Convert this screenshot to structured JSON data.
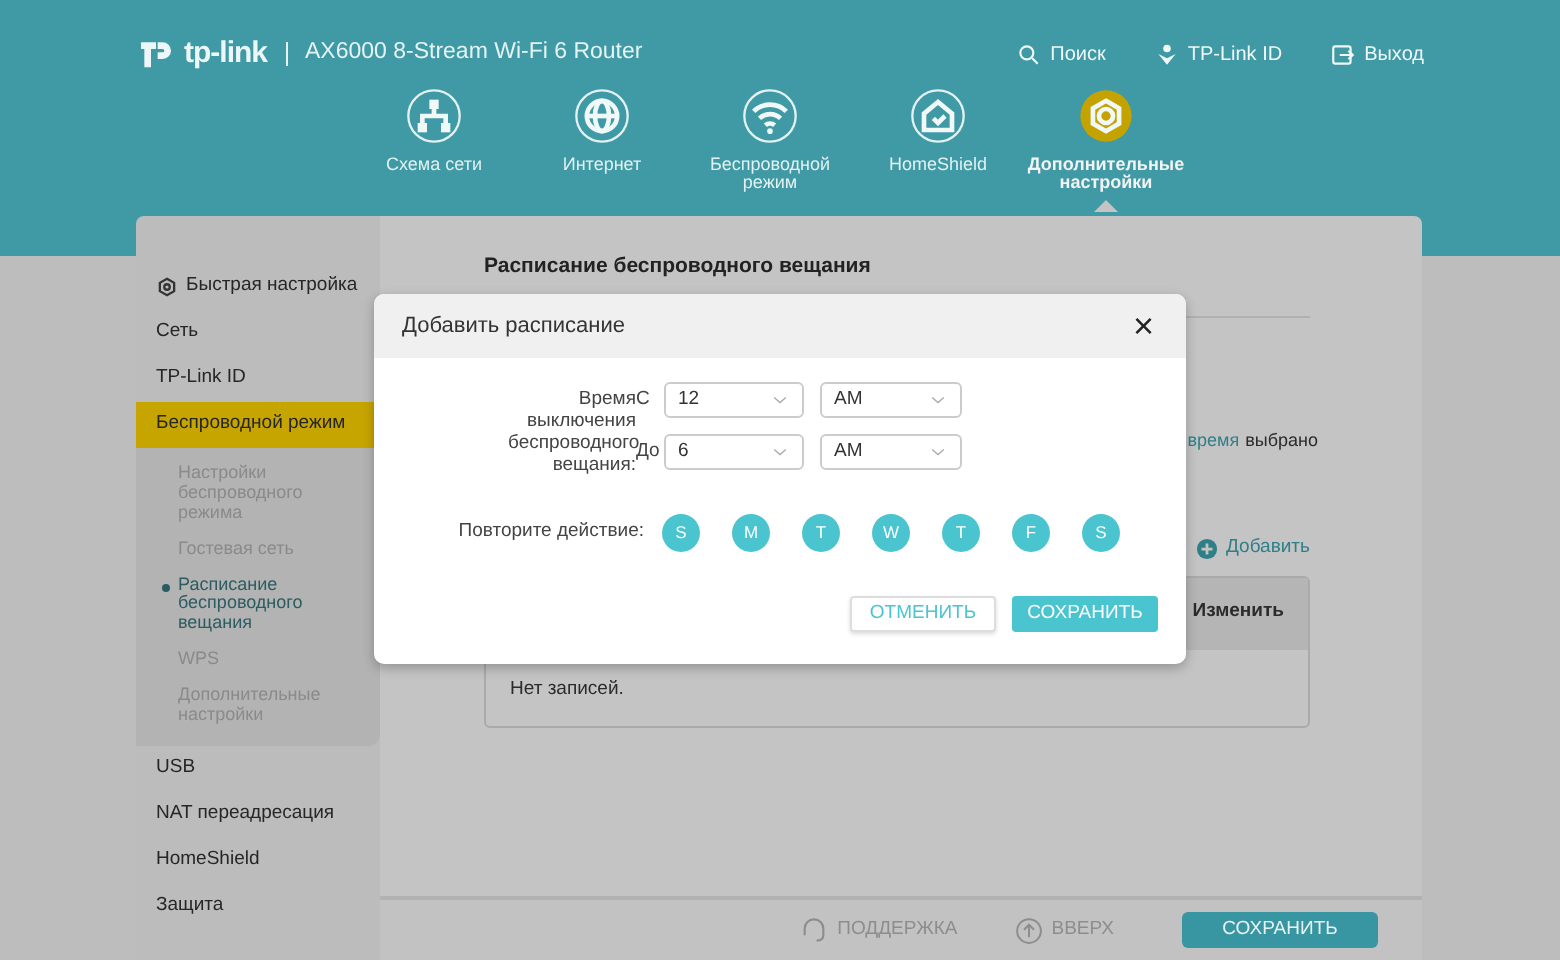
{
  "header": {
    "logo_text": "tp-link",
    "model": "AX6000 8-Stream Wi-Fi 6 Router",
    "links": [
      {
        "label": "Поиск",
        "kind": "search"
      },
      {
        "label": "TP-Link ID",
        "kind": "account"
      },
      {
        "label": "Выход",
        "kind": "logout"
      }
    ],
    "nav": [
      {
        "label": "Схема сети",
        "kind": "network",
        "selected": false
      },
      {
        "label": "Интернет",
        "kind": "globe",
        "selected": false
      },
      {
        "label": "Беспроводной режим",
        "kind": "wifi",
        "selected": false
      },
      {
        "label": "HomeShield",
        "kind": "shield",
        "selected": false
      },
      {
        "label": "Дополнительные настройки",
        "kind": "gear",
        "selected": true
      }
    ]
  },
  "sidebar": {
    "items": [
      {
        "label": "Быстрая настройка",
        "kind": "quick",
        "selected": false
      },
      {
        "label": "Сеть",
        "selected": false
      },
      {
        "label": "TP-Link ID",
        "selected": false
      },
      {
        "label": "Беспроводной режим",
        "selected": true,
        "children": [
          {
            "label": "Настройки беспроводного режима",
            "selected": false
          },
          {
            "label": "Гостевая сеть",
            "selected": false
          },
          {
            "label": "Расписание беспроводного вещания",
            "selected": true
          },
          {
            "label": "WPS",
            "selected": false
          },
          {
            "label": "Дополнительные настройки",
            "selected": false
          }
        ]
      },
      {
        "label": "USB",
        "selected": false
      },
      {
        "label": "NAT переадресация",
        "selected": false
      },
      {
        "label": "HomeShield",
        "selected": false
      },
      {
        "label": "Защита",
        "selected": false
      }
    ]
  },
  "content": {
    "title": "Расписание беспроводного вещания",
    "note": [
      {
        "text": "время",
        "kind": "link"
      },
      {
        "text": "выбрано",
        "kind": "plain"
      }
    ],
    "add_label": "Добавить",
    "table": {
      "columns": [
        "Изменить"
      ],
      "empty_text": "Нет записей."
    }
  },
  "footer": {
    "support": "ПОДДЕРЖКА",
    "top": "ВВЕРХ",
    "save": "СОХРАНИТЬ"
  },
  "modal": {
    "title": "Добавить расписание",
    "close": "×",
    "time_label": "Время выключения беспроводного вещания:",
    "rows": [
      {
        "label": "С",
        "hour": "12",
        "period": "AM"
      },
      {
        "label": "До",
        "hour": "6",
        "period": "AM"
      }
    ],
    "repeat_label": "Повторите действие:",
    "days": [
      {
        "label": "S",
        "selected": true
      },
      {
        "label": "M",
        "selected": true
      },
      {
        "label": "T",
        "selected": true
      },
      {
        "label": "W",
        "selected": true
      },
      {
        "label": "T",
        "selected": true
      },
      {
        "label": "F",
        "selected": true
      },
      {
        "label": "S",
        "selected": true
      }
    ],
    "buttons": [
      {
        "label": "ОТМЕНИТЬ",
        "kind": "secondary"
      },
      {
        "label": "СОХРАНИТЬ",
        "kind": "primary"
      }
    ]
  }
}
